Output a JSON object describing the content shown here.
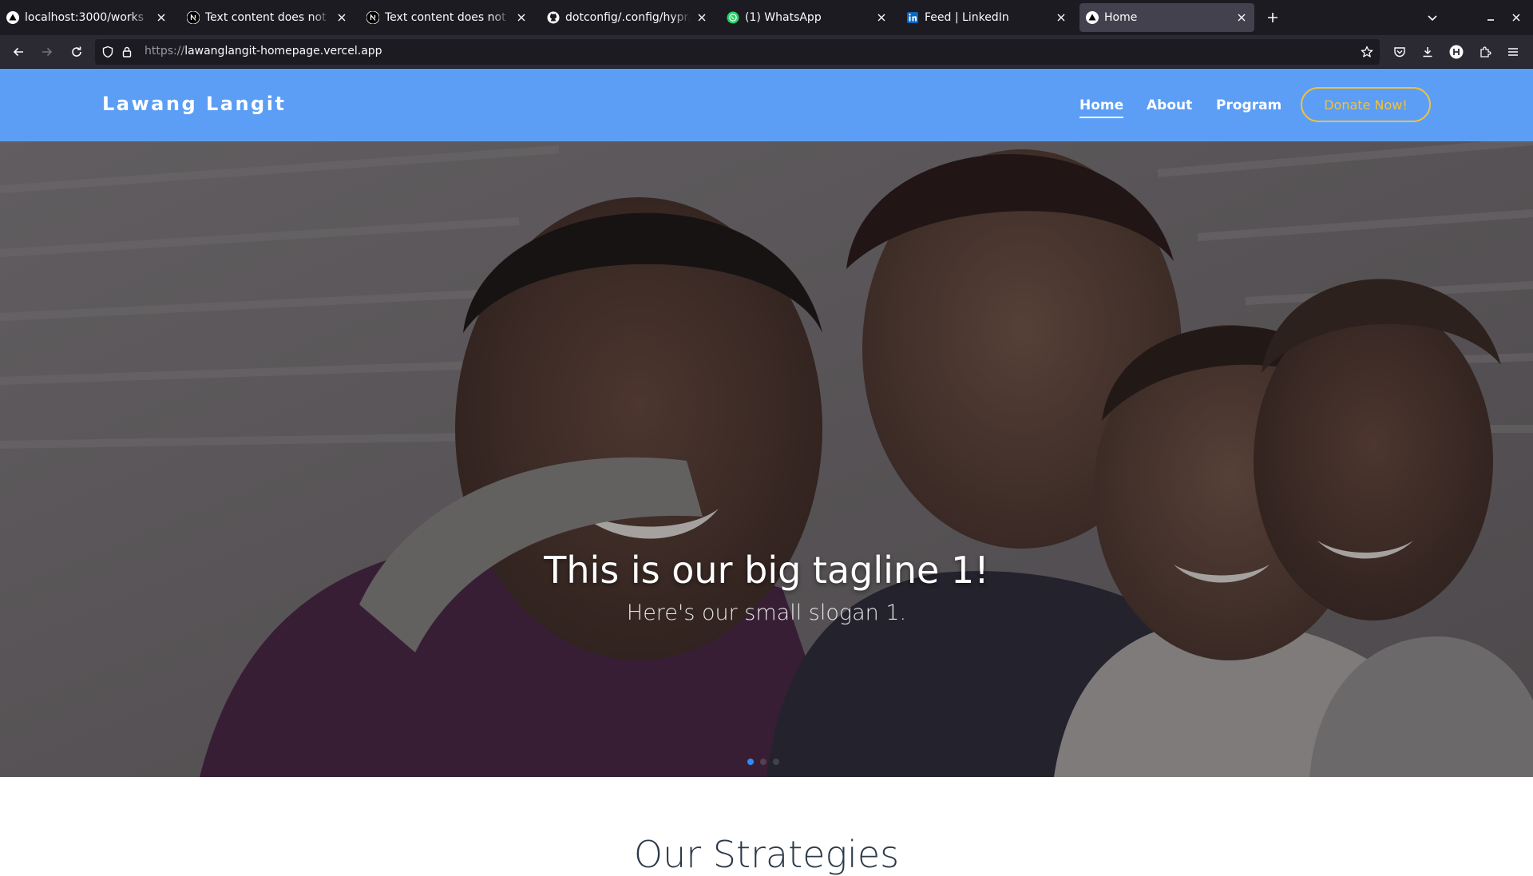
{
  "browser": {
    "tabs": [
      {
        "title": "localhost:3000/works",
        "favicon": "triangle-icon",
        "active": false
      },
      {
        "title": "Text content does not match",
        "favicon": "nextjs-icon",
        "active": false
      },
      {
        "title": "Text content does not match",
        "favicon": "nextjs-icon",
        "active": false
      },
      {
        "title": "dotconfig/.config/hypr/hyprland",
        "favicon": "github-icon",
        "active": false
      },
      {
        "title": "(1) WhatsApp",
        "favicon": "whatsapp-icon",
        "active": false
      },
      {
        "title": "Feed | LinkedIn",
        "favicon": "linkedin-icon",
        "active": false
      },
      {
        "title": "Home",
        "favicon": "triangle-icon",
        "active": true
      }
    ],
    "url": {
      "prefix": "https://",
      "host": "lawanglangit-homepage.vercel.app"
    }
  },
  "site": {
    "brand": "Lawang Langit",
    "menu": {
      "home": "Home",
      "about": "About",
      "program": "Program"
    },
    "donate_label": "Donate Now!",
    "hero": {
      "tagline": "This is our big tagline 1!",
      "slogan": "Here's our small slogan 1.",
      "slide_count": 3,
      "active_slide": 1
    },
    "section_title": "Our Strategies"
  },
  "colors": {
    "header_bg": "#5c9ef5",
    "donate_accent": "#f2c13a",
    "active_dot": "#2f8cff",
    "browser_bg": "#1c1b22",
    "toolbar_bg": "#2b2a33"
  }
}
